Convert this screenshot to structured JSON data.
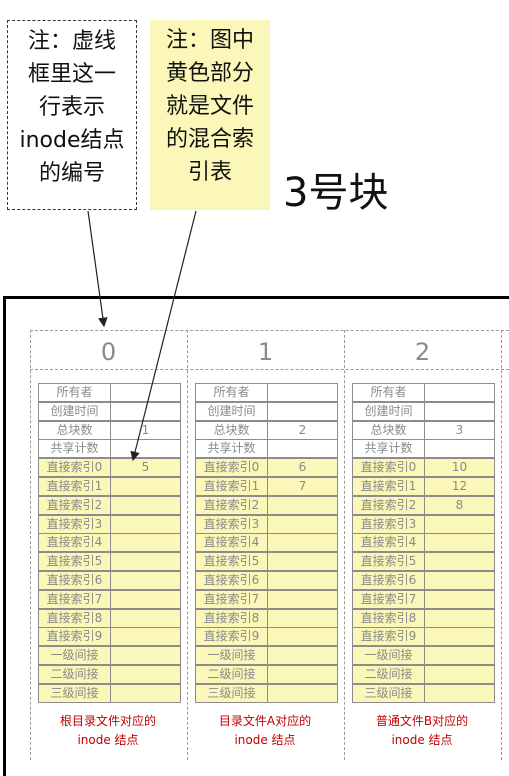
{
  "notes": {
    "note1": [
      "注：虚线",
      "框里这一",
      "行表示",
      "inode结点",
      "的编号"
    ],
    "note2": [
      "注：图中",
      "黄色部分",
      "就是文件",
      "的混合索",
      "引表"
    ]
  },
  "block_title": "3号块",
  "columns": [
    {
      "number": "0",
      "rows": [
        "所有者",
        "创建时间",
        "总块数",
        "共享计数",
        "直接索引0",
        "直接索引1",
        "直接索引2",
        "直接索引3",
        "直接索引4",
        "直接索引5",
        "直接索引6",
        "直接索引7",
        "直接索引8",
        "直接索引9",
        "一级间接",
        "二级间接",
        "三级间接"
      ],
      "values": [
        "",
        "",
        "1",
        "",
        "5",
        "",
        "",
        "",
        "",
        "",
        "",
        "",
        "",
        "",
        "",
        "",
        ""
      ],
      "caption": [
        "根目录文件对应的",
        "inode 结点"
      ]
    },
    {
      "number": "1",
      "rows": [
        "所有者",
        "创建时间",
        "总块数",
        "共享计数",
        "直接索引0",
        "直接索引1",
        "直接索引2",
        "直接索引3",
        "直接索引4",
        "直接索引5",
        "直接索引6",
        "直接索引7",
        "直接索引8",
        "直接索引9",
        "一级间接",
        "二级间接",
        "三级间接"
      ],
      "values": [
        "",
        "",
        "2",
        "",
        "6",
        "7",
        "",
        "",
        "",
        "",
        "",
        "",
        "",
        "",
        "",
        "",
        ""
      ],
      "caption": [
        "目录文件A对应的",
        "inode 结点"
      ]
    },
    {
      "number": "2",
      "rows": [
        "所有者",
        "创建时间",
        "总块数",
        "共享计数",
        "直接索引0",
        "直接索引1",
        "直接索引2",
        "直接索引3",
        "直接索引4",
        "直接索引5",
        "直接索引6",
        "直接索引7",
        "直接索引8",
        "直接索引9",
        "一级间接",
        "二级间接",
        "三级间接"
      ],
      "values": [
        "",
        "",
        "3",
        "",
        "10",
        "12",
        "8",
        "",
        "",
        "",
        "",
        "",
        "",
        "",
        "",
        "",
        ""
      ],
      "caption": [
        "普通文件B对应的",
        "inode 结点"
      ]
    }
  ],
  "colors": {
    "highlight": "#fbf7b8",
    "caption": "#c00000",
    "border": "#8c8c8c"
  }
}
